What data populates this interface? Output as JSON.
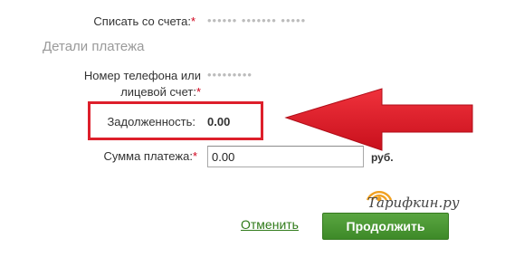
{
  "form": {
    "account_label": "Списать со счета:",
    "account_value": "•••••• ••••••• •••••",
    "section_title": "Детали платежа",
    "phone_label_line1": "Номер телефона или",
    "phone_label_line2": "лицевой счет:",
    "phone_value": "•••••••••",
    "debt_label": "Задолженность:",
    "debt_value": "0.00",
    "amount_label": "Сумма платежа:",
    "amount_value": "0.00",
    "amount_unit": "руб.",
    "required_mark": "*"
  },
  "actions": {
    "cancel_label": "Отменить",
    "continue_label": "Продолжить"
  },
  "watermark": {
    "logo_text": "Тарифкин.ру"
  },
  "colors": {
    "highlight_red": "#dd1f2b",
    "button_green": "#4a9a33",
    "link_green": "#2f7a19",
    "required_red": "#d0001a"
  }
}
